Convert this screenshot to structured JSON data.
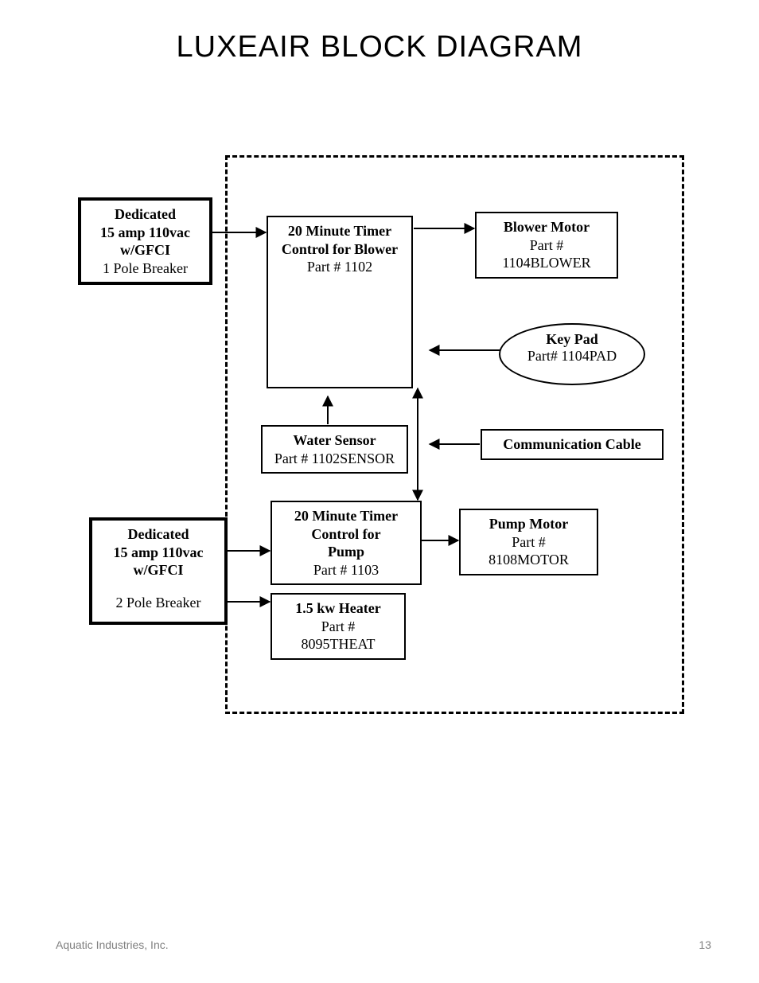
{
  "title": "LUXEAIR BLOCK DIAGRAM",
  "footer": {
    "company": "Aquatic Industries, Inc.",
    "page": "13"
  },
  "nodes": {
    "breaker1": {
      "l1": "Dedicated",
      "l2": "15 amp 110vac",
      "l3": "w/GFCI",
      "l4": "1 Pole Breaker"
    },
    "breaker2": {
      "l1": "Dedicated",
      "l2": "15 amp 110vac",
      "l3": "w/GFCI",
      "l4": "2 Pole Breaker"
    },
    "timerBlower": {
      "l1": "20 Minute Timer",
      "l2": "Control for Blower",
      "l3": "Part # 1102"
    },
    "blowerMotor": {
      "l1": "Blower Motor",
      "l2": "Part #",
      "l3": "1104BLOWER"
    },
    "keypad": {
      "l1": "Key Pad",
      "l2": "Part# 1104PAD"
    },
    "waterSensor": {
      "l1": "Water Sensor",
      "l2": "Part # 1102SENSOR"
    },
    "commCable": {
      "l1": "Communication Cable"
    },
    "timerPump": {
      "l1": "20 Minute Timer",
      "l2": "Control for",
      "l3": "Pump",
      "l4": "Part # 1103"
    },
    "pumpMotor": {
      "l1": "Pump Motor",
      "l2": "Part #",
      "l3": "8108MOTOR"
    },
    "heater": {
      "l1": "1.5 kw Heater",
      "l2": "Part #",
      "l3": "8095THEAT"
    }
  }
}
